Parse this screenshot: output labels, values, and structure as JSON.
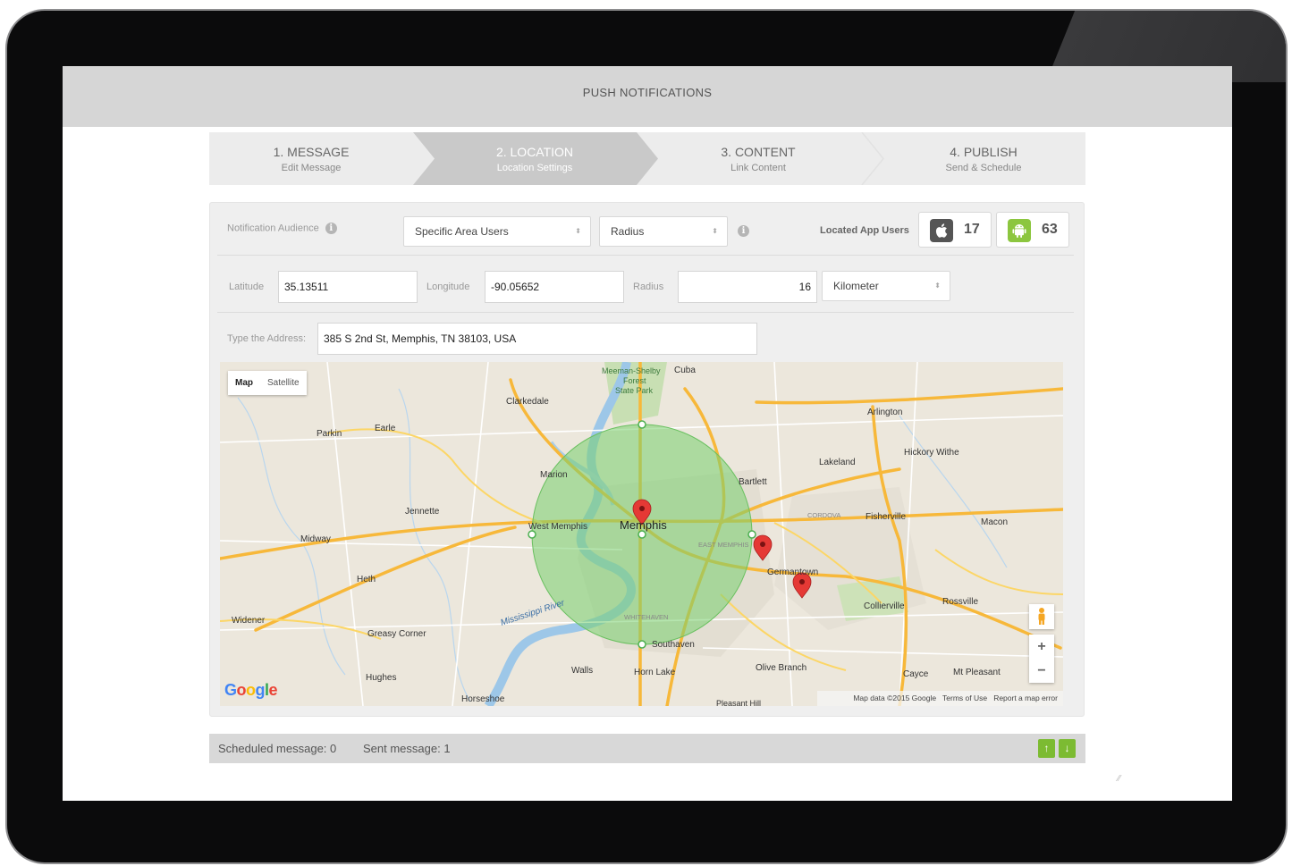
{
  "header": {
    "title": "PUSH NOTIFICATIONS"
  },
  "steps": [
    {
      "title": "1. MESSAGE",
      "subtitle": "Edit Message"
    },
    {
      "title": "2. LOCATION",
      "subtitle": "Location Settings"
    },
    {
      "title": "3. CONTENT",
      "subtitle": "Link Content"
    },
    {
      "title": "4. PUBLISH",
      "subtitle": "Send & Schedule"
    }
  ],
  "audience": {
    "label": "Notification Audience",
    "selected": "Specific Area Users",
    "mode": "Radius",
    "located_label": "Located App Users",
    "ios_count": "17",
    "android_count": "63"
  },
  "location": {
    "latitude_label": "Latitude",
    "latitude": "35.13511",
    "longitude_label": "Longitude",
    "longitude": "-90.05652",
    "radius_label": "Radius",
    "radius": "16",
    "unit": "Kilometer"
  },
  "address": {
    "label": "Type the Address:",
    "value": "385 S 2nd St, Memphis, TN 38103, USA"
  },
  "map": {
    "type_map": "Map",
    "type_satellite": "Satellite",
    "zoom_in": "+",
    "zoom_out": "−",
    "logo": "Google",
    "attribution": "Map data ©2015 Google",
    "terms": "Terms of Use",
    "report": "Report a map error",
    "places": {
      "memphis": "Memphis",
      "west_memphis": "West Memphis",
      "marion": "Marion",
      "bartlett": "Bartlett",
      "lakeland": "Lakeland",
      "arlington": "Arlington",
      "hickory_withe": "Hickory Withe",
      "fisherville": "Fisherville",
      "macon": "Macon",
      "germantown": "Germantown",
      "collierville": "Collierville",
      "rossville": "Rossville",
      "southaven": "Southaven",
      "olive_branch": "Olive Branch",
      "horn_lake": "Horn Lake",
      "walls": "Walls",
      "cayce": "Cayce",
      "mt_pleasant": "Mt Pleasant",
      "clarkedale": "Clarkedale",
      "earle": "Earle",
      "parkin": "Parkin",
      "jennette": "Jennette",
      "midway": "Midway",
      "heth": "Heth",
      "widener": "Widener",
      "greasy_corner": "Greasy Corner",
      "hughes": "Hughes",
      "horseshoe": "Horseshoe",
      "cuba": "Cuba",
      "meeman_shelby": "Meeman-Shelby",
      "forest": "Forest",
      "state_park": "State Park",
      "mississippi_river": "Mississippi River",
      "cordova": "CORDOVA",
      "east_memphis": "EAST MEMPHIS",
      "whitehaven": "WHITEHAVEN",
      "pleasant_hill": "Pleasant Hill"
    }
  },
  "footer": {
    "scheduled": "Scheduled message: 0",
    "sent": "Sent message: 1",
    "up": "↑",
    "down": "↓"
  },
  "colors": {
    "accent_green": "#7cbb32",
    "android_green": "#8cc63f",
    "radius_fill": "#79d06e",
    "marker_red": "#e53935",
    "active_step": "#c4c4c4"
  }
}
